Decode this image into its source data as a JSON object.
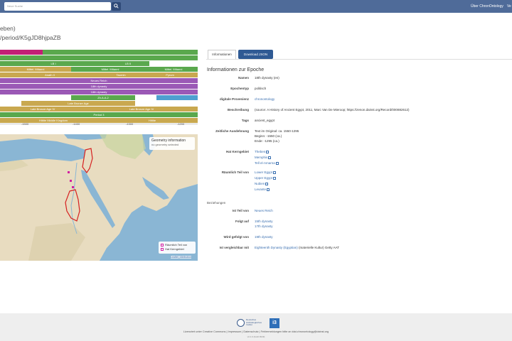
{
  "navbar": {
    "search_placeholder": "Neue Suche",
    "about_label": "Über ChronOntology",
    "lang_label": "Ve"
  },
  "page": {
    "title": "eben)",
    "uri": "/period/K5gJD8hjpaZB"
  },
  "timeline": {
    "rows": [
      {
        "label": "",
        "color": "#c21f75"
      },
      {
        "label": "",
        "color": "#5aa84d"
      },
      {
        "label": "",
        "color": "#5aa84d"
      },
      {
        "label": "LB I",
        "color": "#5aa84d"
      },
      {
        "label": "LB II",
        "color": "#5aa84d"
      },
      {
        "label": "Mittel. Mitanni",
        "color": "#c9a84f"
      },
      {
        "label": "Mittel. Mitanni",
        "color": "#5aa84d"
      },
      {
        "label": "Mittel. Mitanni",
        "color": "#5aa84d"
      },
      {
        "label": "Anath II",
        "color": "#c9a84f"
      },
      {
        "label": "Taurnin",
        "color": "#c9a84f"
      },
      {
        "label": "Pyrum",
        "color": "#c9a84f"
      },
      {
        "label": "Neues Reich",
        "color": "#9b59b6"
      },
      {
        "label": "18th dynasty",
        "color": "#9b59b6"
      },
      {
        "label": "18th dynasty",
        "color": "#9b59b6"
      },
      {
        "label": "Zh.A.A.2",
        "color": "#5aa84d"
      },
      {
        "label": "",
        "color": "#4f9fd0"
      },
      {
        "label": "Late Bronze Age",
        "color": "#c9a84f"
      },
      {
        "label": "Late Bronze Age IV",
        "color": "#c9a84f"
      },
      {
        "label": "Late Bronze Age IV",
        "color": "#c9a84f"
      },
      {
        "label": "Period 3",
        "color": "#5aa84d"
      },
      {
        "label": "Hittite Middle Kingdom",
        "color": "#c9a84f"
      },
      {
        "label": "Hittite",
        "color": "#c9a84f"
      }
    ],
    "ticks": [
      "-1500",
      "-1400",
      "-1300",
      "-1200"
    ]
  },
  "map": {
    "geo_title": "Geometry information",
    "geo_sub": "no geometry selected",
    "legend": [
      "Räumlich Teil von",
      "Hat Kerngebiet"
    ],
    "attribution": "Leaflet | Attribution"
  },
  "tabs": {
    "info": "Informationen",
    "json": "Download JSON"
  },
  "info": {
    "section_title": "Informationen zur Epoche",
    "fields": [
      {
        "label": "Namen",
        "value": "18th dynasty (en)"
      },
      {
        "label": "Epochentyp",
        "value": "politisch"
      },
      {
        "label": "digitale Provenienz",
        "value": "chronontology"
      },
      {
        "label": "Beschreibung",
        "value": "(source: A History of Ancient Egypt, 2011, Marc Van De Mieroop; https://zenon.dainst.org/Record/000882612)"
      },
      {
        "label": "Tags",
        "value": "ancient_egypt"
      }
    ],
    "time_label": "Zeitliche Ausdehnung",
    "time_lines": [
      "Text im Original: ca. 1550-1295",
      "Beginn: -1550 (ca.)",
      "Ende: -1295 (ca.)"
    ],
    "core_label": "Hat Kerngebiet",
    "core_items": [
      "Theben",
      "Memphis",
      "Tell el-Amarna"
    ],
    "part_label": "Räumlich Teil von",
    "part_items": [
      "Lower Egypt",
      "Upper Egypt",
      "Nubien",
      "Levante"
    ],
    "rel_heading": "Beziehungen",
    "rel_part_label": "Ist Teil von",
    "rel_part_value": "Neues Reich",
    "rel_follows_label": "Folgt auf",
    "rel_follows_items": [
      "15th dynasty",
      "17th dynasty"
    ],
    "rel_followed_label": "Wird gefolgt von",
    "rel_followed_value": "19th dynasty",
    "rel_comp_label": "Ist vergleichbar mit",
    "rel_comp_link": "Eighteenth Dynasty (Egyptian)",
    "rel_comp_rest": "(materielle Kultur) Getty AAT"
  },
  "footer": {
    "dai_text": "Deutsches Archäologisches Institut",
    "i3_text": "i3",
    "text": "Lizenziert unter Creative Commons | Impressum | Datenschutz | Fehlermeldungen bitte an idai.chronontology@dainst.org",
    "version": "v0.1.0 (build 9949)"
  }
}
